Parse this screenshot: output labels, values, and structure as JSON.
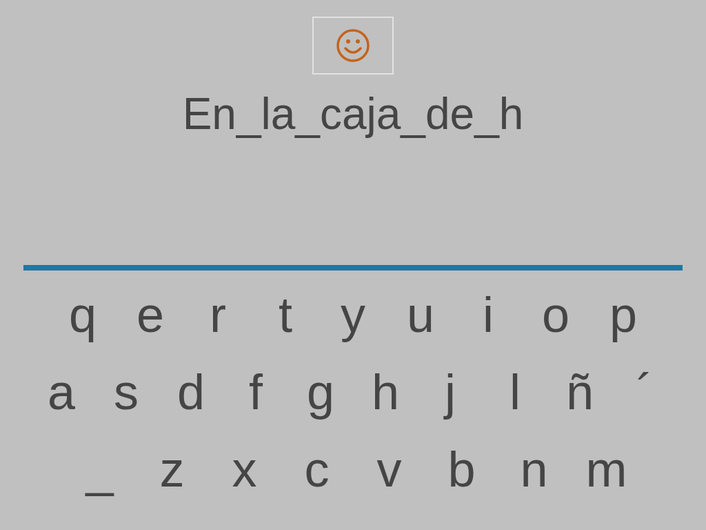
{
  "prompt": {
    "text": "En_la_caja_de_h"
  },
  "keyboard": {
    "rows": [
      {
        "keys": [
          "q",
          "e",
          "r",
          "t",
          "y",
          "u",
          "i",
          "o",
          "p"
        ]
      },
      {
        "keys": [
          "a",
          "s",
          "d",
          "f",
          "g",
          "h",
          "j",
          "l",
          "ñ",
          "´"
        ]
      },
      {
        "keys": [
          "_",
          "z",
          "x",
          "c",
          "v",
          "b",
          "n",
          "m"
        ]
      }
    ]
  }
}
